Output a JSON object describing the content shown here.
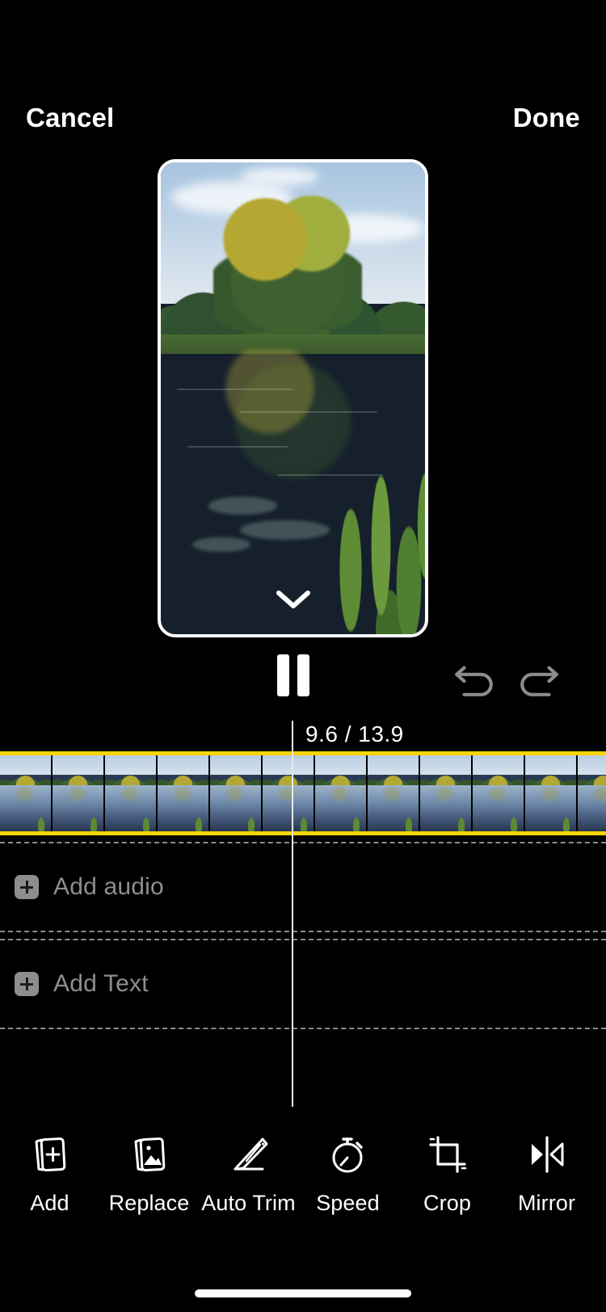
{
  "header": {
    "cancel_label": "Cancel",
    "done_label": "Done"
  },
  "preview": {
    "collapse_icon": "chevron-down-icon",
    "scene_description": "river with large tree and reflections"
  },
  "transport": {
    "pause_label": "pause-icon",
    "undo_label": "undo-icon",
    "redo_label": "redo-icon"
  },
  "timeline": {
    "timecode": "9.6 / 13.9",
    "current_time": "9.6",
    "total_time": "13.9",
    "clip_border_color": "#f5d400",
    "playhead_color": "#e8e8e8",
    "tracks": [
      {
        "id": "audio",
        "label": "Add audio",
        "icon": "plus-icon"
      },
      {
        "id": "text",
        "label": "Add Text",
        "icon": "plus-icon"
      }
    ]
  },
  "toolbar": {
    "items": [
      {
        "label": "Add",
        "icon": "add-clip-icon"
      },
      {
        "label": "Replace",
        "icon": "replace-clip-icon"
      },
      {
        "label": "Auto Trim",
        "icon": "auto-trim-icon"
      },
      {
        "label": "Speed",
        "icon": "stopwatch-icon"
      },
      {
        "label": "Crop",
        "icon": "crop-icon"
      },
      {
        "label": "Mirror",
        "icon": "mirror-icon"
      }
    ]
  }
}
